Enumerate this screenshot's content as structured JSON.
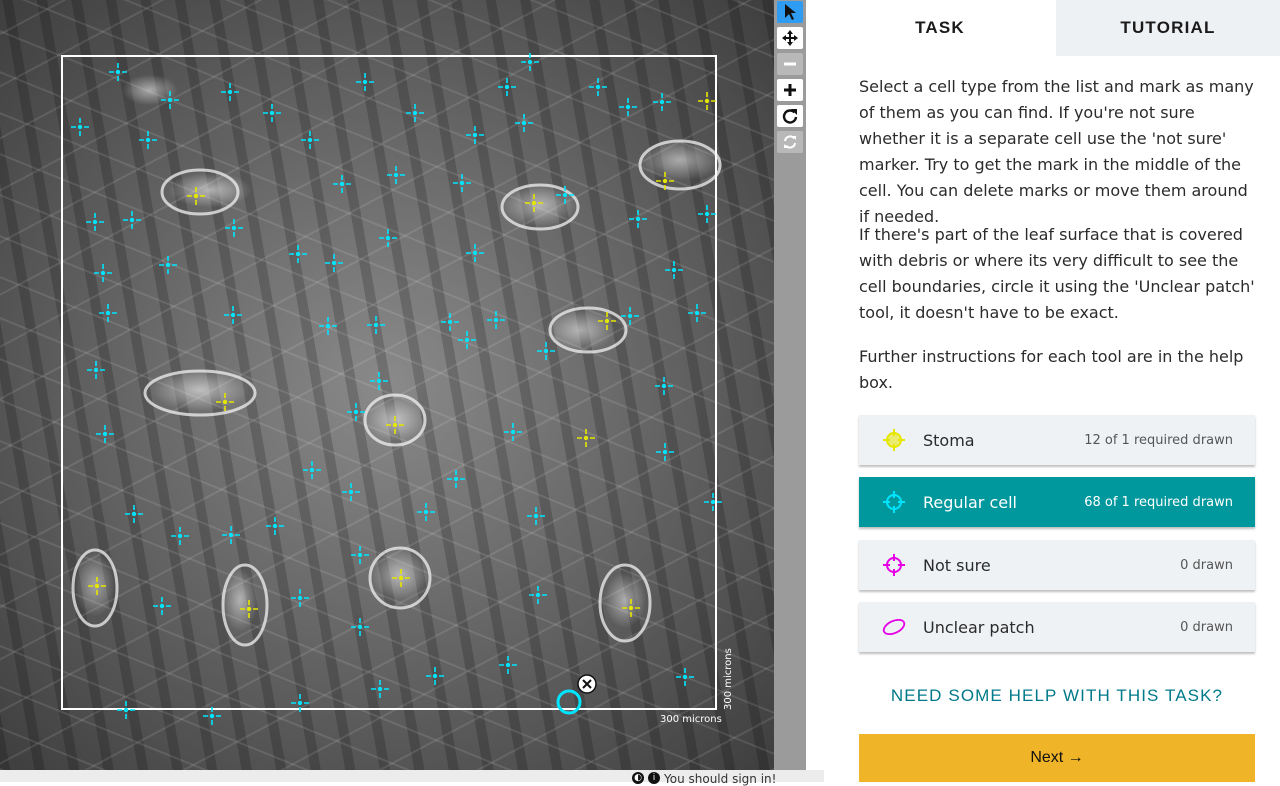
{
  "viewer": {
    "scale_bar_bottom": "300 microns",
    "scale_bar_right": "300 microns"
  },
  "toolbar": {
    "tools": [
      {
        "name": "pointer",
        "icon": "cursor-arrow-icon",
        "active": true
      },
      {
        "name": "move",
        "icon": "move-arrows-icon"
      },
      {
        "name": "zoom-out",
        "icon": "minus-icon",
        "disabled": true
      },
      {
        "name": "zoom-in",
        "icon": "plus-icon"
      },
      {
        "name": "rotate",
        "icon": "rotate-icon"
      },
      {
        "name": "reset",
        "icon": "reset-icon",
        "disabled": true
      }
    ]
  },
  "tabs": {
    "task": "TASK",
    "tutorial": "TUTORIAL"
  },
  "instructions": {
    "p1": "Select a cell type from the list and mark as many of them as you can find. If you're not sure whether it is a separate cell use the 'not sure' marker. Try to get the mark in the middle of the cell. You can delete marks or move them around if needed.",
    "p2": "If there's part of the leaf surface that is covered with debris or where its very difficult to see the cell boundaries, circle it using the 'Unclear patch' tool, it doesn't have to be exact.",
    "p3": "Further instructions for each tool are in the help box."
  },
  "tools": [
    {
      "label": "Stoma",
      "count": "12 of 1 required drawn",
      "color": "#e6e600",
      "icon": "crosshair-icon"
    },
    {
      "label": "Regular cell",
      "count": "68 of 1 required drawn",
      "color": "#00e5ff",
      "icon": "crosshair-icon",
      "selected": true
    },
    {
      "label": "Not sure",
      "count": "0 drawn",
      "color": "#e600e6",
      "icon": "crosshair-icon"
    },
    {
      "label": "Unclear patch",
      "count": "0 drawn",
      "color": "#e600e6",
      "icon": "ellipse-icon"
    }
  ],
  "help_link": "NEED SOME HELP WITH THIS TASK?",
  "next_button": "Next →",
  "footer": {
    "signin_text": "You should sign in!"
  },
  "colors": {
    "regular_marker": "#00e5ff",
    "stoma_marker": "#e6e600",
    "accent_teal": "#00979d",
    "next_yellow": "#f0b429",
    "active_tool_blue": "#2f9cf3"
  }
}
